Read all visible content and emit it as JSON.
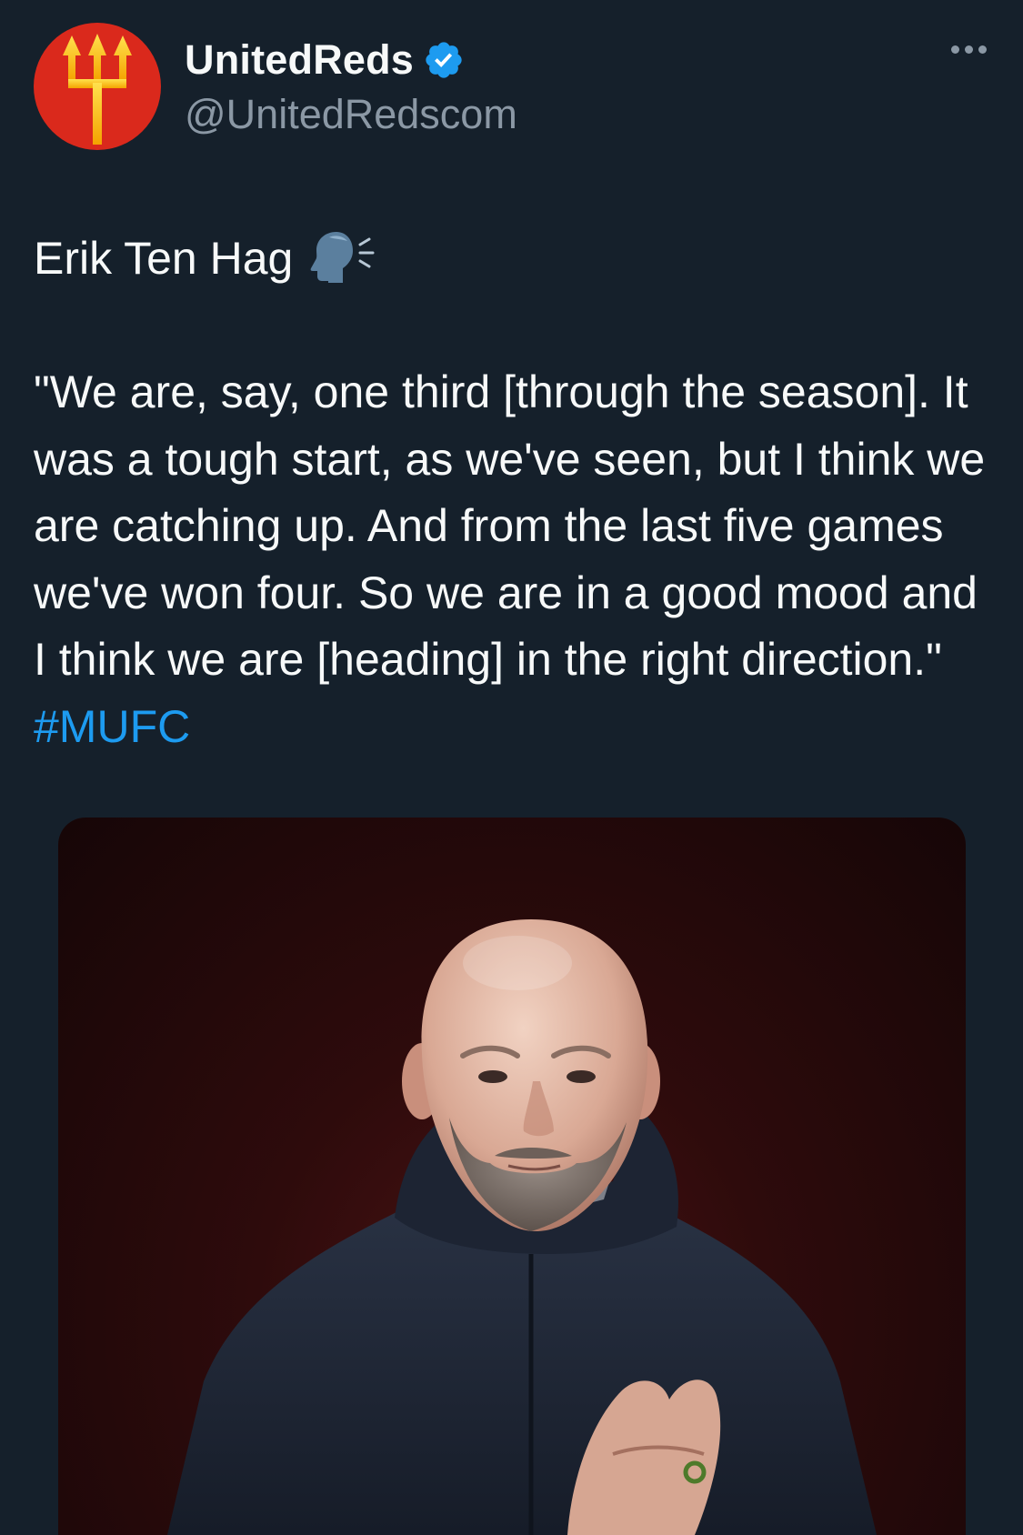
{
  "author": {
    "display_name": "UnitedReds",
    "handle": "@UnitedRedscom",
    "verified": true,
    "avatar_icon": "trident-icon",
    "avatar_color": "#da291c"
  },
  "menu": {
    "icon": "more-options-icon"
  },
  "tweet": {
    "heading": "Erik Ten Hag",
    "heading_icon": "speaking-head-icon",
    "quote": "\"We are, say, one third [through the season]. It was a tough start, as we've seen, but I think we are catching up. And from the last five games we've won four. So we are in a good mood and I think we are [heading] in the right direction.\"",
    "hashtag": "#MUFC"
  },
  "media": {
    "type": "photo"
  },
  "colors": {
    "background": "#15202b",
    "text": "#f7f9f9",
    "secondary": "#8b98a5",
    "link": "#1d9bf0",
    "verified": "#1d9bf0"
  }
}
